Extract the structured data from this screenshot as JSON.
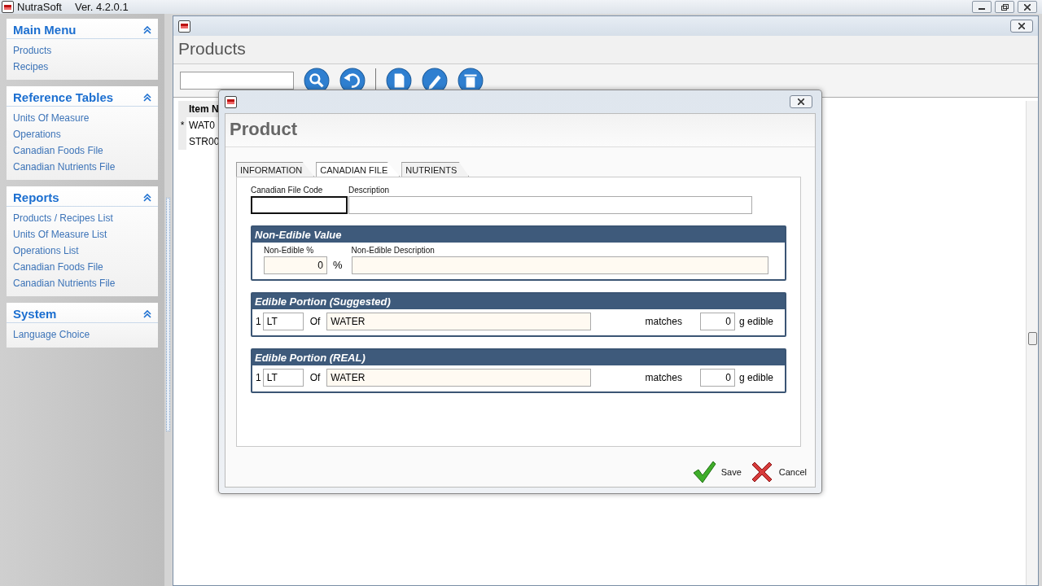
{
  "app": {
    "title": "NutraSoft",
    "version": "Ver. 4.2.0.1"
  },
  "sidebar": {
    "sections": [
      {
        "title": "Main Menu",
        "expanded": true,
        "items": [
          "Products",
          "Recipes"
        ]
      },
      {
        "title": "Reference Tables",
        "expanded": true,
        "items": [
          "Units Of Measure",
          "Operations",
          "Canadian Foods File",
          "Canadian Nutrients File"
        ]
      },
      {
        "title": "Reports",
        "expanded": true,
        "items": [
          "Products / Recipes List",
          "Units Of Measure List",
          "Operations List",
          "Canadian Foods File",
          "Canadian Nutrients File"
        ]
      },
      {
        "title": "System",
        "expanded": true,
        "items": [
          "Language Choice"
        ]
      }
    ]
  },
  "products_window": {
    "title": "Products",
    "grid": {
      "columns": [
        "Item N"
      ],
      "rows": [
        {
          "marker": "*",
          "cells": [
            "WAT0"
          ]
        },
        {
          "marker": "",
          "cells": [
            "STR00"
          ]
        }
      ]
    }
  },
  "dialog": {
    "title": "Product",
    "tabs": [
      {
        "label": "INFORMATION",
        "selected": false
      },
      {
        "label": "CANADIAN FILE",
        "selected": true
      },
      {
        "label": "NUTRIENTS",
        "selected": false
      }
    ],
    "code_label": "Canadian File Code",
    "description_label": "Description",
    "non_edible": {
      "title": "Non-Edible Value",
      "percent_label": "Non-Edible %",
      "percent": "0",
      "unit": "%",
      "description_label": "Non-Edible Description"
    },
    "portions": [
      {
        "title": "Edible Portion (Suggested)",
        "qty": "1",
        "unit": "LT",
        "of": "Of",
        "food": "WATER",
        "matches": "matches",
        "grams": "0",
        "suffix": "g edible"
      },
      {
        "title": "Edible Portion (REAL)",
        "qty": "1",
        "unit": "LT",
        "of": "Of",
        "food": "WATER",
        "matches": "matches",
        "grams": "0",
        "suffix": "g edible"
      }
    ],
    "buttons": [
      {
        "kind": "save",
        "label": "Save"
      },
      {
        "kind": "cancel",
        "label": "Cancel"
      }
    ]
  }
}
